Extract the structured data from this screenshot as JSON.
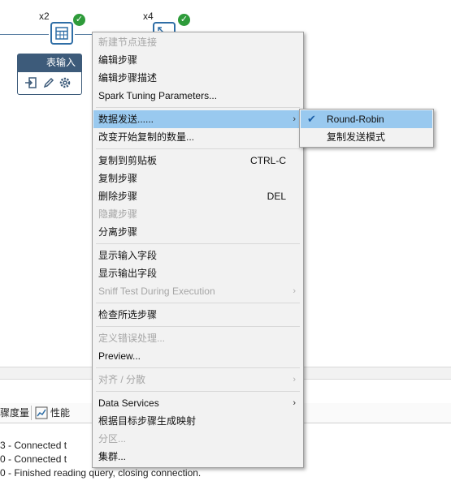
{
  "canvas": {
    "step1": {
      "copies": "x2",
      "label": "表输入"
    },
    "step2": {
      "copies": "x4"
    }
  },
  "menu": {
    "items": [
      {
        "label": "新建节点连接",
        "disabled": true
      },
      {
        "label": "编辑步骤"
      },
      {
        "label": "编辑步骤描述"
      },
      {
        "label": "Spark Tuning Parameters..."
      },
      {
        "label": "数据发送......",
        "submenu": true,
        "highlighted": true
      },
      {
        "label": "改变开始复制的数量..."
      },
      {
        "label": "复制到剪贴板",
        "shortcut": "CTRL-C"
      },
      {
        "label": "复制步骤"
      },
      {
        "label": "删除步骤",
        "shortcut": "DEL"
      },
      {
        "label": "隐藏步骤",
        "disabled": true
      },
      {
        "label": "分离步骤"
      },
      {
        "label": "显示输入字段"
      },
      {
        "label": "显示输出字段"
      },
      {
        "label": "Sniff Test During Execution",
        "disabled": true,
        "submenu": true
      },
      {
        "label": "检查所选步骤"
      },
      {
        "label": "定义错误处理...",
        "disabled": true
      },
      {
        "label": "Preview..."
      },
      {
        "label": "对齐 / 分散",
        "disabled": true,
        "submenu": true
      },
      {
        "label": "Data Services",
        "submenu": true
      },
      {
        "label": "根据目标步骤生成映射"
      },
      {
        "label": "分区...",
        "disabled": true
      },
      {
        "label": "集群..."
      }
    ]
  },
  "submenu": {
    "items": [
      {
        "label": "Round-Robin",
        "checked": true,
        "highlighted": true
      },
      {
        "label": "复制发送模式"
      }
    ]
  },
  "bottom": {
    "tabs": [
      "骤度量",
      "性能"
    ],
    "log": [
      "3 - Connected t",
      "0 - Connected t",
      "0 - Finished reading query, closing connection."
    ]
  },
  "colors": {
    "highlight": "#99c9ef",
    "menu_bg": "#f2f2f2",
    "step_border": "#2f6ea6",
    "check": "#2e9b3a"
  }
}
